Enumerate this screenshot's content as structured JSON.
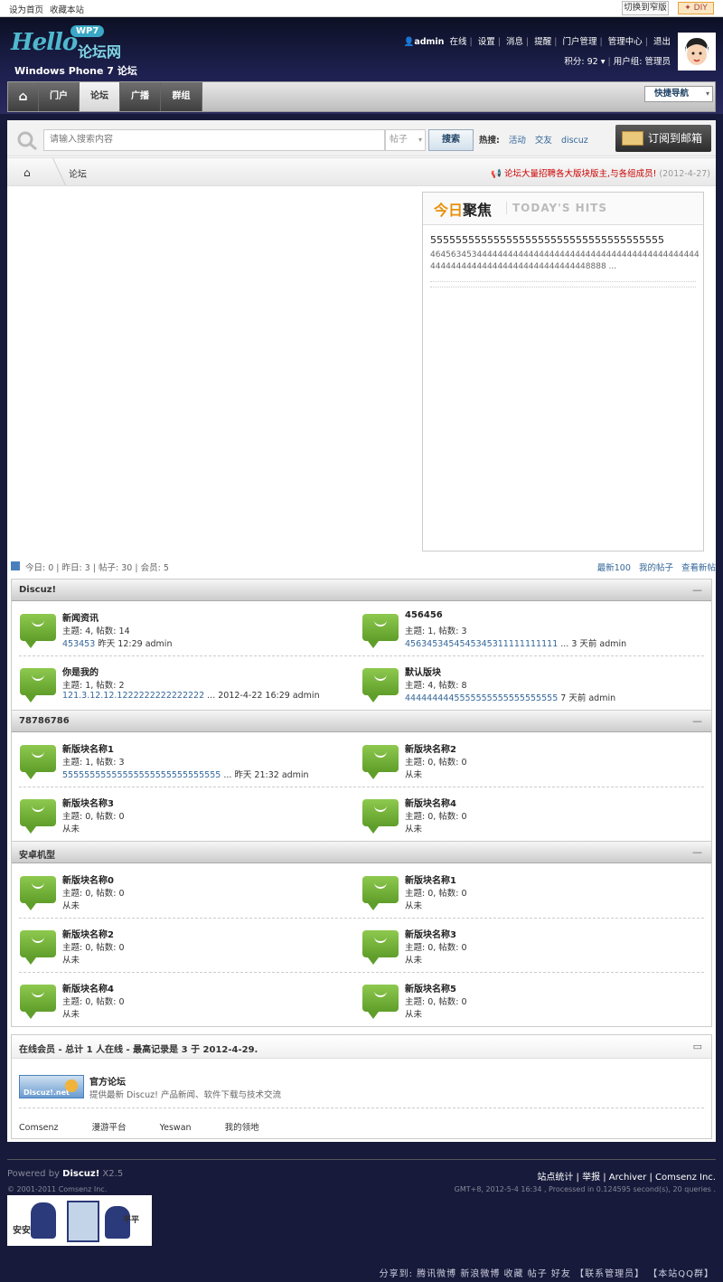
{
  "topbar": {
    "set_home": "设为首页",
    "bookmark": "收藏本站",
    "switch": "切换到窄版",
    "diy": "✦ DIY"
  },
  "logo": {
    "hello": "Hello",
    "wp7": "WP7",
    "cn_name": "论坛网",
    "subtitle": "Windows Phone 7 论坛"
  },
  "user": {
    "name": "admin",
    "status": "在线",
    "links": [
      "设置",
      "消息",
      "提醒",
      "门户管理",
      "管理中心",
      "退出"
    ],
    "credits": "积分: 92 ▾",
    "group": "用户组: 管理员"
  },
  "nav": {
    "items": [
      {
        "label": "⌂"
      },
      {
        "label": "门户"
      },
      {
        "label": "论坛"
      },
      {
        "label": "广播"
      },
      {
        "label": "群组"
      }
    ],
    "quick_nav": "快捷导航"
  },
  "search": {
    "placeholder": "请输入搜索内容",
    "type": "帖子",
    "button": "搜索",
    "hot_label": "热搜:",
    "hot": [
      "活动",
      "交友",
      "discuz"
    ],
    "subscribe": "订阅到邮箱"
  },
  "breadcrumb": {
    "home": "⌂",
    "current": "论坛",
    "announcement": "论坛大量招聘各大版块版主,与各组成员!",
    "announcement_date": "(2012-4-27)"
  },
  "hot": {
    "title_a": "今日",
    "title_b": "聚焦",
    "title_en": "TODAY'S HITS",
    "headline": "5555555555555555555555555555555555555",
    "summary": "46456345344444444444444444444444444444444444444444444444444444444444444444444444448888 ..."
  },
  "stats": {
    "today": "今日: 0",
    "yesterday": "昨日: 3",
    "posts": "帖子: 30",
    "members": "会员: 5",
    "links": [
      "最新100",
      "我的帖子",
      "查看新帖"
    ]
  },
  "groups": [
    {
      "title": "Discuz!",
      "collapse": "—",
      "forums": [
        {
          "name": "新闻资讯",
          "counts": "主题: 4, 帖数: 14",
          "last_link": "453453",
          "last_meta": " 昨天 12:29 admin"
        },
        {
          "name": "456456",
          "counts": "主题: 1, 帖数: 3",
          "last_link": "4563453454545345311111111111",
          "last_meta": " ... 3 天前 admin"
        },
        {
          "name": "你是我的",
          "counts": "主题: 1, 帖数: 2",
          "last_link": "121.3.12.12.1222222222222222",
          "last_meta": " ... 2012-4-22 16:29 admin"
        },
        {
          "name": "默认版块",
          "counts": "主题: 4, 帖数: 8",
          "last_link": "4444444445555555555555555555",
          "last_meta": " 7 天前 admin"
        }
      ]
    },
    {
      "title": "78786786",
      "collapse": "—",
      "forums": [
        {
          "name": "新版块名称1",
          "counts": "主题: 1, 帖数: 3",
          "last_link": "55555555555555555555555555555",
          "last_meta": " ... 昨天 21:32 admin"
        },
        {
          "name": "新版块名称2",
          "counts": "主题: 0, 帖数: 0",
          "last_link": "",
          "last_meta": "从未"
        },
        {
          "name": "新版块名称3",
          "counts": "主题: 0, 帖数: 0",
          "last_link": "",
          "last_meta": "从未"
        },
        {
          "name": "新版块名称4",
          "counts": "主题: 0, 帖数: 0",
          "last_link": "",
          "last_meta": "从未"
        }
      ]
    },
    {
      "title": "安卓机型",
      "collapse": "—",
      "forums": [
        {
          "name": "新版块名称0",
          "counts": "主题: 0, 帖数: 0",
          "last_link": "",
          "last_meta": "从未"
        },
        {
          "name": "新版块名称1",
          "counts": "主题: 0, 帖数: 0",
          "last_link": "",
          "last_meta": "从未"
        },
        {
          "name": "新版块名称2",
          "counts": "主题: 0, 帖数: 0",
          "last_link": "",
          "last_meta": "从未"
        },
        {
          "name": "新版块名称3",
          "counts": "主题: 0, 帖数: 0",
          "last_link": "",
          "last_meta": "从未"
        },
        {
          "name": "新版块名称4",
          "counts": "主题: 0, 帖数: 0",
          "last_link": "",
          "last_meta": "从未"
        },
        {
          "name": "新版块名称5",
          "counts": "主题: 0, 帖数: 0",
          "last_link": "",
          "last_meta": "从未"
        }
      ]
    }
  ],
  "online": {
    "title": "在线会员 - 总计 1 人在线 - 最高记录是 3 于 2012-4-29.",
    "toggle": "▭",
    "badge": "Discuz!.net",
    "link_name": "官方论坛",
    "link_desc": "提供最新 Discuz! 产品新闻、软件下载与技术交流",
    "links": [
      "Comsenz",
      "漫游平台",
      "Yeswan",
      "我的领地"
    ]
  },
  "footer": {
    "powered": "Powered by ",
    "brand": "Discuz!",
    "version": " X2.5",
    "copyright": "© 2001-2011 Comsenz Inc.",
    "links": "站点统计 | 举报 | Archiver | Comsenz Inc.",
    "gmt": "GMT+8, 2012-5-4 16:34 , Processed in 0.124595 second(s), 20 queries .",
    "police_1": "安安",
    "police_2": "平平"
  },
  "share": "分享到: 腾讯微博 新浪微博 收藏 帖子 好友 【联系管理员】 【本站QQ群】",
  "colors": {
    "accent": "#336699",
    "nav_dark": "#3f3f3f",
    "bubble": "#6fae36",
    "background": "#171a3a"
  }
}
